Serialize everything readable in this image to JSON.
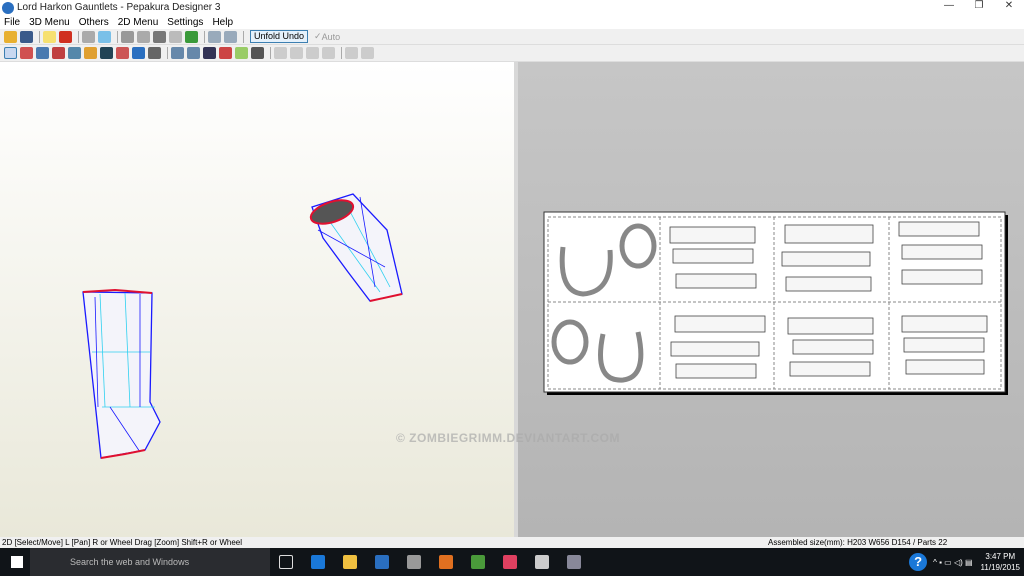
{
  "window": {
    "title": "Lord Harkon Gauntlets - Pepakura Designer 3",
    "controls": [
      "—",
      "❐",
      "✕"
    ]
  },
  "menu": [
    "File",
    "3D Menu",
    "Others",
    "2D Menu",
    "Settings",
    "Help"
  ],
  "toolbar1": {
    "unfold_undo": "Unfold Undo",
    "auto": "Auto",
    "auto_checked": true
  },
  "watermark": "© ZOMBIEGRIMM.DEVIANTART.COM",
  "status": {
    "left": "2D [Select/Move] L [Pan] R or Wheel Drag [Zoom] Shift+R or Wheel",
    "right": "Assembled size(mm): H203 W656 D154 / Parts 22"
  },
  "taskbar": {
    "search_placeholder": "Search the web and Windows",
    "time": "3:47 PM",
    "date": "11/19/2015",
    "help": "?"
  },
  "colors": {
    "edge_blue": "#1a1aff",
    "edge_red": "#e01030",
    "fold_cyan": "#30d0f0"
  }
}
